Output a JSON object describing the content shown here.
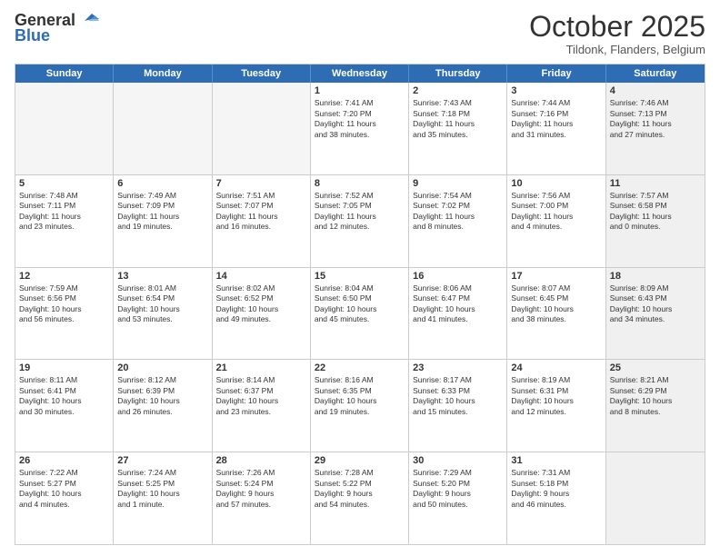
{
  "header": {
    "logo_general": "General",
    "logo_blue": "Blue",
    "month_title": "October 2025",
    "location": "Tildonk, Flanders, Belgium"
  },
  "weekdays": [
    "Sunday",
    "Monday",
    "Tuesday",
    "Wednesday",
    "Thursday",
    "Friday",
    "Saturday"
  ],
  "rows": [
    [
      {
        "day": "",
        "text": "",
        "empty": true
      },
      {
        "day": "",
        "text": "",
        "empty": true
      },
      {
        "day": "",
        "text": "",
        "empty": true
      },
      {
        "day": "1",
        "text": "Sunrise: 7:41 AM\nSunset: 7:20 PM\nDaylight: 11 hours\nand 38 minutes."
      },
      {
        "day": "2",
        "text": "Sunrise: 7:43 AM\nSunset: 7:18 PM\nDaylight: 11 hours\nand 35 minutes."
      },
      {
        "day": "3",
        "text": "Sunrise: 7:44 AM\nSunset: 7:16 PM\nDaylight: 11 hours\nand 31 minutes."
      },
      {
        "day": "4",
        "text": "Sunrise: 7:46 AM\nSunset: 7:13 PM\nDaylight: 11 hours\nand 27 minutes.",
        "shaded": true
      }
    ],
    [
      {
        "day": "5",
        "text": "Sunrise: 7:48 AM\nSunset: 7:11 PM\nDaylight: 11 hours\nand 23 minutes."
      },
      {
        "day": "6",
        "text": "Sunrise: 7:49 AM\nSunset: 7:09 PM\nDaylight: 11 hours\nand 19 minutes."
      },
      {
        "day": "7",
        "text": "Sunrise: 7:51 AM\nSunset: 7:07 PM\nDaylight: 11 hours\nand 16 minutes."
      },
      {
        "day": "8",
        "text": "Sunrise: 7:52 AM\nSunset: 7:05 PM\nDaylight: 11 hours\nand 12 minutes."
      },
      {
        "day": "9",
        "text": "Sunrise: 7:54 AM\nSunset: 7:02 PM\nDaylight: 11 hours\nand 8 minutes."
      },
      {
        "day": "10",
        "text": "Sunrise: 7:56 AM\nSunset: 7:00 PM\nDaylight: 11 hours\nand 4 minutes."
      },
      {
        "day": "11",
        "text": "Sunrise: 7:57 AM\nSunset: 6:58 PM\nDaylight: 11 hours\nand 0 minutes.",
        "shaded": true
      }
    ],
    [
      {
        "day": "12",
        "text": "Sunrise: 7:59 AM\nSunset: 6:56 PM\nDaylight: 10 hours\nand 56 minutes."
      },
      {
        "day": "13",
        "text": "Sunrise: 8:01 AM\nSunset: 6:54 PM\nDaylight: 10 hours\nand 53 minutes."
      },
      {
        "day": "14",
        "text": "Sunrise: 8:02 AM\nSunset: 6:52 PM\nDaylight: 10 hours\nand 49 minutes."
      },
      {
        "day": "15",
        "text": "Sunrise: 8:04 AM\nSunset: 6:50 PM\nDaylight: 10 hours\nand 45 minutes."
      },
      {
        "day": "16",
        "text": "Sunrise: 8:06 AM\nSunset: 6:47 PM\nDaylight: 10 hours\nand 41 minutes."
      },
      {
        "day": "17",
        "text": "Sunrise: 8:07 AM\nSunset: 6:45 PM\nDaylight: 10 hours\nand 38 minutes."
      },
      {
        "day": "18",
        "text": "Sunrise: 8:09 AM\nSunset: 6:43 PM\nDaylight: 10 hours\nand 34 minutes.",
        "shaded": true
      }
    ],
    [
      {
        "day": "19",
        "text": "Sunrise: 8:11 AM\nSunset: 6:41 PM\nDaylight: 10 hours\nand 30 minutes."
      },
      {
        "day": "20",
        "text": "Sunrise: 8:12 AM\nSunset: 6:39 PM\nDaylight: 10 hours\nand 26 minutes."
      },
      {
        "day": "21",
        "text": "Sunrise: 8:14 AM\nSunset: 6:37 PM\nDaylight: 10 hours\nand 23 minutes."
      },
      {
        "day": "22",
        "text": "Sunrise: 8:16 AM\nSunset: 6:35 PM\nDaylight: 10 hours\nand 19 minutes."
      },
      {
        "day": "23",
        "text": "Sunrise: 8:17 AM\nSunset: 6:33 PM\nDaylight: 10 hours\nand 15 minutes."
      },
      {
        "day": "24",
        "text": "Sunrise: 8:19 AM\nSunset: 6:31 PM\nDaylight: 10 hours\nand 12 minutes."
      },
      {
        "day": "25",
        "text": "Sunrise: 8:21 AM\nSunset: 6:29 PM\nDaylight: 10 hours\nand 8 minutes.",
        "shaded": true
      }
    ],
    [
      {
        "day": "26",
        "text": "Sunrise: 7:22 AM\nSunset: 5:27 PM\nDaylight: 10 hours\nand 4 minutes."
      },
      {
        "day": "27",
        "text": "Sunrise: 7:24 AM\nSunset: 5:25 PM\nDaylight: 10 hours\nand 1 minute."
      },
      {
        "day": "28",
        "text": "Sunrise: 7:26 AM\nSunset: 5:24 PM\nDaylight: 9 hours\nand 57 minutes."
      },
      {
        "day": "29",
        "text": "Sunrise: 7:28 AM\nSunset: 5:22 PM\nDaylight: 9 hours\nand 54 minutes."
      },
      {
        "day": "30",
        "text": "Sunrise: 7:29 AM\nSunset: 5:20 PM\nDaylight: 9 hours\nand 50 minutes."
      },
      {
        "day": "31",
        "text": "Sunrise: 7:31 AM\nSunset: 5:18 PM\nDaylight: 9 hours\nand 46 minutes."
      },
      {
        "day": "",
        "text": "",
        "empty": true,
        "shaded": true
      }
    ]
  ]
}
